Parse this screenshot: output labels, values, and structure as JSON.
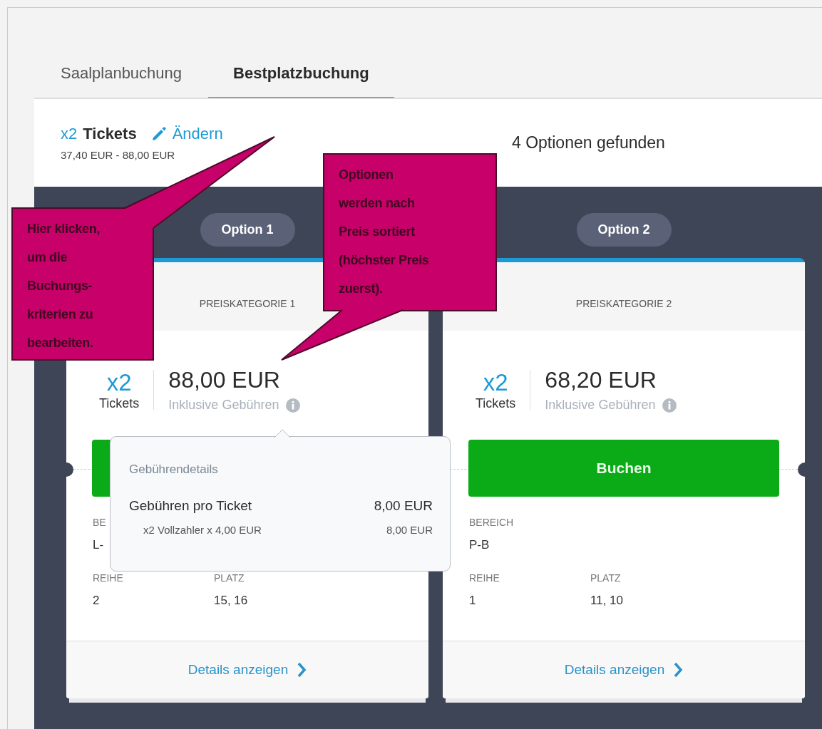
{
  "tabs": [
    {
      "label": "Saalplanbuchung",
      "selected": false
    },
    {
      "label": "Bestplatzbuchung",
      "selected": true
    }
  ],
  "summary": {
    "quantity": "x2",
    "label": "Tickets",
    "edit_link": "Ändern",
    "price_range": "37,40 EUR - 88,00 EUR",
    "result_count": "4 Optionen gefunden"
  },
  "options": [
    {
      "badge": "Option 1",
      "category": "PREISKATEGORIE 1",
      "quantity": "x2",
      "quantity_label": "Tickets",
      "price": "88,00 EUR",
      "price_note": "Inklusive Gebühren",
      "detail_rows": [
        [
          {
            "label": "BE",
            "value": "L-"
          }
        ],
        [
          {
            "label": "REIHE",
            "value": "2"
          },
          {
            "label": "PLATZ",
            "value": "15, 16"
          }
        ]
      ],
      "footer_link": "Details anzeigen"
    },
    {
      "badge": "Option 2",
      "category": "PREISKATEGORIE 2",
      "quantity": "x2",
      "quantity_label": "Tickets",
      "price": "68,20 EUR",
      "price_note": "Inklusive Gebühren",
      "book_button": "Buchen",
      "detail_rows": [
        [
          {
            "label": "BEREICH",
            "value": "P-B"
          }
        ],
        [
          {
            "label": "REIHE",
            "value": "1"
          },
          {
            "label": "PLATZ",
            "value": "11, 10"
          }
        ]
      ],
      "footer_link": "Details anzeigen"
    }
  ],
  "fee_tooltip": {
    "title": "Gebührendetails",
    "rows": [
      {
        "kind": "total",
        "label": "Gebühren pro Ticket",
        "value": "8,00 EUR"
      },
      {
        "kind": "item",
        "label": "x2 Vollzahler x 4,00 EUR",
        "value": "8,00 EUR"
      }
    ]
  },
  "callouts": [
    {
      "text": "Hier klicken,\num die\nBuchungs-\nkriterien zu\nbearbeiten."
    },
    {
      "text": "Optionen\nwerden nach\nPreis sortiert\n(höchster Preis\nzuerst)."
    }
  ]
}
